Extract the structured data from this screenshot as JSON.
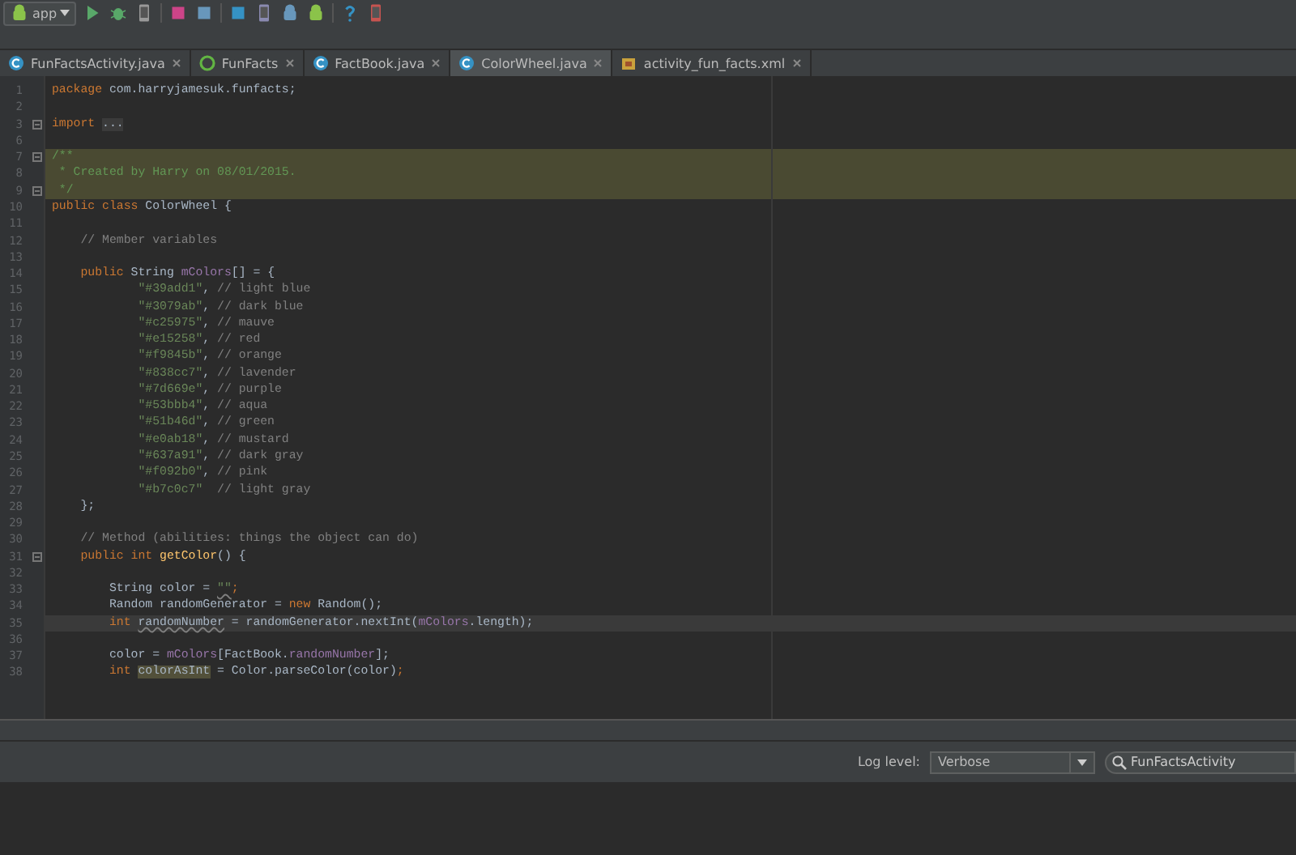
{
  "toolbar": {
    "run_config": "app"
  },
  "tabs": [
    {
      "label": "FunFactsActivity.java",
      "kind": "class",
      "selected": false
    },
    {
      "label": "FunFacts",
      "kind": "module",
      "selected": false
    },
    {
      "label": "FactBook.java",
      "kind": "class",
      "selected": false
    },
    {
      "label": "ColorWheel.java",
      "kind": "class",
      "selected": true
    },
    {
      "label": "activity_fun_facts.xml",
      "kind": "layout",
      "selected": false
    }
  ],
  "editor": {
    "lines": [
      {
        "n": "1",
        "fold": false,
        "highlighted": false,
        "current": false,
        "tokens": [
          {
            "kind": "kw",
            "text": "package "
          },
          {
            "kind": "plain",
            "text": "com.harryjamesuk.funfacts;"
          }
        ]
      },
      {
        "n": "2",
        "fold": false
      },
      {
        "n": "3",
        "fold": true,
        "highlighted": false,
        "current": false,
        "tokens": [
          {
            "kind": "kw",
            "text": "import "
          },
          {
            "kind": "folded",
            "text": "..."
          }
        ]
      },
      {
        "n": "6",
        "fold": false
      },
      {
        "n": "7",
        "fold": true,
        "highlighted": true,
        "current": false,
        "tokens": [
          {
            "kind": "doc",
            "text": "/**"
          }
        ]
      },
      {
        "n": "8",
        "fold": false,
        "highlighted": true,
        "current": false,
        "tokens": [
          {
            "kind": "doc",
            "text": " * Created by Harry on 08/01/2015."
          }
        ]
      },
      {
        "n": "9",
        "fold": true,
        "highlighted": true,
        "current": false,
        "tokens": [
          {
            "kind": "doc",
            "text": " */"
          }
        ]
      },
      {
        "n": "10",
        "fold": false,
        "highlighted": false,
        "current": false,
        "tokens": [
          {
            "kind": "kw",
            "text": "public class "
          },
          {
            "kind": "plain",
            "text": "ColorWheel {"
          }
        ]
      },
      {
        "n": "11",
        "fold": false
      },
      {
        "n": "12",
        "fold": false,
        "highlighted": false,
        "current": false,
        "tokens": [
          {
            "kind": "comment",
            "text": "    // Member variables"
          }
        ]
      },
      {
        "n": "13",
        "fold": false
      },
      {
        "n": "14",
        "fold": false,
        "highlighted": false,
        "current": false,
        "tokens": [
          {
            "kind": "kw",
            "text": "    public "
          },
          {
            "kind": "plain",
            "text": "String "
          },
          {
            "kind": "field",
            "text": "mColors"
          },
          {
            "kind": "plain",
            "text": "[] = {"
          }
        ]
      },
      {
        "n": "15",
        "fold": false,
        "highlighted": false,
        "current": false,
        "tokens": [
          {
            "kind": "str",
            "text": "            \"#39add1\""
          },
          {
            "kind": "plain",
            "text": ", "
          },
          {
            "kind": "comment",
            "text": "// light blue"
          }
        ]
      },
      {
        "n": "16",
        "fold": false,
        "highlighted": false,
        "current": false,
        "tokens": [
          {
            "kind": "str",
            "text": "            \"#3079ab\""
          },
          {
            "kind": "plain",
            "text": ", "
          },
          {
            "kind": "comment",
            "text": "// dark blue"
          }
        ]
      },
      {
        "n": "17",
        "fold": false,
        "highlighted": false,
        "current": false,
        "tokens": [
          {
            "kind": "str",
            "text": "            \"#c25975\""
          },
          {
            "kind": "plain",
            "text": ", "
          },
          {
            "kind": "comment",
            "text": "// mauve"
          }
        ]
      },
      {
        "n": "18",
        "fold": false,
        "highlighted": false,
        "current": false,
        "tokens": [
          {
            "kind": "str",
            "text": "            \"#e15258\""
          },
          {
            "kind": "plain",
            "text": ", "
          },
          {
            "kind": "comment",
            "text": "// red"
          }
        ]
      },
      {
        "n": "19",
        "fold": false,
        "highlighted": false,
        "current": false,
        "tokens": [
          {
            "kind": "str",
            "text": "            \"#f9845b\""
          },
          {
            "kind": "plain",
            "text": ", "
          },
          {
            "kind": "comment",
            "text": "// orange"
          }
        ]
      },
      {
        "n": "20",
        "fold": false,
        "highlighted": false,
        "current": false,
        "tokens": [
          {
            "kind": "str",
            "text": "            \"#838cc7\""
          },
          {
            "kind": "plain",
            "text": ", "
          },
          {
            "kind": "comment",
            "text": "// lavender"
          }
        ]
      },
      {
        "n": "21",
        "fold": false,
        "highlighted": false,
        "current": false,
        "tokens": [
          {
            "kind": "str",
            "text": "            \"#7d669e\""
          },
          {
            "kind": "plain",
            "text": ", "
          },
          {
            "kind": "comment",
            "text": "// purple"
          }
        ]
      },
      {
        "n": "22",
        "fold": false,
        "highlighted": false,
        "current": false,
        "tokens": [
          {
            "kind": "str",
            "text": "            \"#53bbb4\""
          },
          {
            "kind": "plain",
            "text": ", "
          },
          {
            "kind": "comment",
            "text": "// aqua"
          }
        ]
      },
      {
        "n": "23",
        "fold": false,
        "highlighted": false,
        "current": false,
        "tokens": [
          {
            "kind": "str",
            "text": "            \"#51b46d\""
          },
          {
            "kind": "plain",
            "text": ", "
          },
          {
            "kind": "comment",
            "text": "// green"
          }
        ]
      },
      {
        "n": "24",
        "fold": false,
        "highlighted": false,
        "current": false,
        "tokens": [
          {
            "kind": "str",
            "text": "            \"#e0ab18\""
          },
          {
            "kind": "plain",
            "text": ", "
          },
          {
            "kind": "comment",
            "text": "// mustard"
          }
        ]
      },
      {
        "n": "25",
        "fold": false,
        "highlighted": false,
        "current": false,
        "tokens": [
          {
            "kind": "str",
            "text": "            \"#637a91\""
          },
          {
            "kind": "plain",
            "text": ", "
          },
          {
            "kind": "comment",
            "text": "// dark gray"
          }
        ]
      },
      {
        "n": "26",
        "fold": false,
        "highlighted": false,
        "current": false,
        "tokens": [
          {
            "kind": "str",
            "text": "            \"#f092b0\""
          },
          {
            "kind": "plain",
            "text": ", "
          },
          {
            "kind": "comment",
            "text": "// pink"
          }
        ]
      },
      {
        "n": "27",
        "fold": false,
        "highlighted": false,
        "current": false,
        "tokens": [
          {
            "kind": "str",
            "text": "            \"#b7c0c7\""
          },
          {
            "kind": "comment",
            "text": "  // light gray"
          }
        ]
      },
      {
        "n": "28",
        "fold": false,
        "highlighted": false,
        "current": false,
        "tokens": [
          {
            "kind": "plain",
            "text": "    };"
          }
        ]
      },
      {
        "n": "29",
        "fold": false
      },
      {
        "n": "30",
        "fold": false,
        "highlighted": false,
        "current": false,
        "tokens": [
          {
            "kind": "comment",
            "text": "    // Method (abilities: things the object can do)"
          }
        ]
      },
      {
        "n": "31",
        "fold": true,
        "highlighted": false,
        "current": false,
        "tokens": [
          {
            "kind": "kw",
            "text": "    public int "
          },
          {
            "kind": "method",
            "text": "getColor"
          },
          {
            "kind": "plain",
            "text": "() {"
          }
        ]
      },
      {
        "n": "32",
        "fold": false
      },
      {
        "n": "33",
        "fold": false,
        "highlighted": false,
        "current": false,
        "tokens": [
          {
            "kind": "plain",
            "text": "        String color = "
          },
          {
            "kind": "warnstr",
            "text": "\"\""
          },
          {
            "kind": "kw",
            "text": ";"
          }
        ]
      },
      {
        "n": "34",
        "fold": false,
        "highlighted": false,
        "current": false,
        "tokens": [
          {
            "kind": "plain",
            "text": "        Random randomGenerator = "
          },
          {
            "kind": "kw",
            "text": "new "
          },
          {
            "kind": "plain",
            "text": "Random();"
          }
        ]
      },
      {
        "n": "35",
        "fold": false,
        "highlighted": false,
        "current": true,
        "tokens": [
          {
            "kind": "kw",
            "text": "        int "
          },
          {
            "kind": "warn",
            "text": "randomNumber"
          },
          {
            "kind": "plain",
            "text": " = randomGenerator.nextInt("
          },
          {
            "kind": "field",
            "text": "mColors"
          },
          {
            "kind": "plain",
            "text": ".length);"
          }
        ]
      },
      {
        "n": "36",
        "fold": false
      },
      {
        "n": "37",
        "fold": false,
        "highlighted": false,
        "current": false,
        "tokens": [
          {
            "kind": "plain",
            "text": "        color = "
          },
          {
            "kind": "field",
            "text": "mColors"
          },
          {
            "kind": "plain",
            "text": "[FactBook."
          },
          {
            "kind": "field",
            "text": "randomNumber"
          },
          {
            "kind": "plain",
            "text": "];"
          }
        ]
      },
      {
        "n": "38",
        "fold": false,
        "highlighted": false,
        "current": false,
        "tokens": [
          {
            "kind": "kw",
            "text": "        int "
          },
          {
            "kind": "mark",
            "text": "colorAsInt"
          },
          {
            "kind": "plain",
            "text": " = Color.parseColor(color)"
          },
          {
            "kind": "kw",
            "text": ";"
          }
        ]
      }
    ]
  },
  "logcat": {
    "log_level_label": "Log level:",
    "log_level": "Verbose",
    "filter": "FunFactsActivity"
  }
}
